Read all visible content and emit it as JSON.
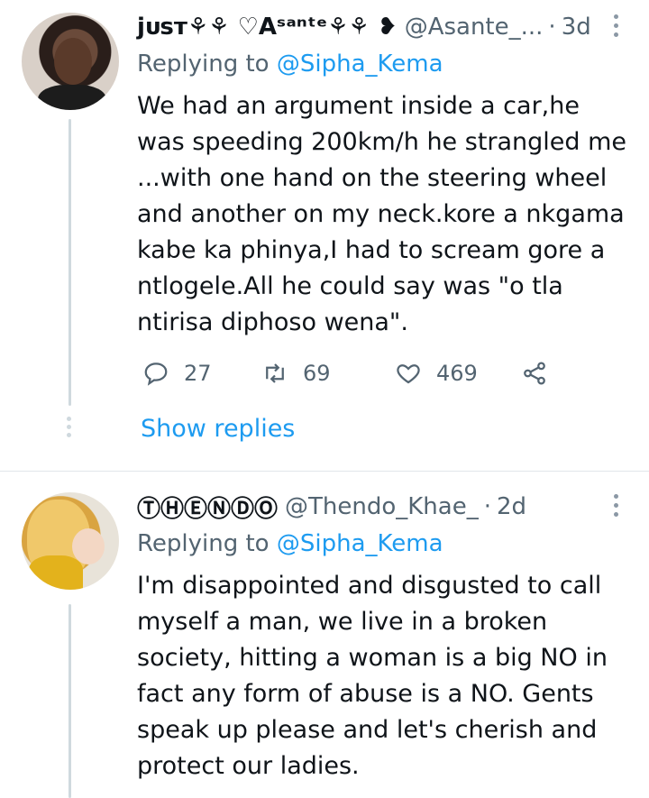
{
  "tweets": [
    {
      "author_name": "jᴜsᴛ⚘⚘ ♡Aˢᵃⁿᵗᵉ⚘⚘ ❥",
      "handle": "@Asante_...",
      "dot": "·",
      "time": "3d",
      "replying_prefix": "Replying to",
      "replying_to": "@Sipha_Kema",
      "body": "We had an argument inside a car,he was speeding 200km/h he strangled me ...with one hand on the steering wheel and another on my neck.kore a nkgama kabe ka phinya,I had to scream gore  a ntlogele.All he could say was \"o tla ntirisa diphoso wena\".",
      "replies": "27",
      "retweets": "69",
      "likes": "469",
      "show_replies": "Show replies"
    },
    {
      "author_name": "ⓉⒽⒺⓃⒹⓄ",
      "handle": "@Thendo_Khae_",
      "dot": "·",
      "time": "2d",
      "replying_prefix": "Replying to",
      "replying_to": "@Sipha_Kema",
      "body": "I'm disappointed and disgusted to call myself a man, we live in a broken society, hitting a woman is a big NO in fact any form of abuse is a NO. Gents speak up please and let's cherish and protect our ladies."
    }
  ],
  "colors": {
    "accent": "#1d9bf0",
    "secondary_text": "#536471",
    "primary_text": "#0f1419",
    "divider": "#e1e6ea"
  },
  "icons": [
    "reply-icon",
    "retweet-icon",
    "like-icon",
    "share-icon",
    "more-options-icon"
  ]
}
